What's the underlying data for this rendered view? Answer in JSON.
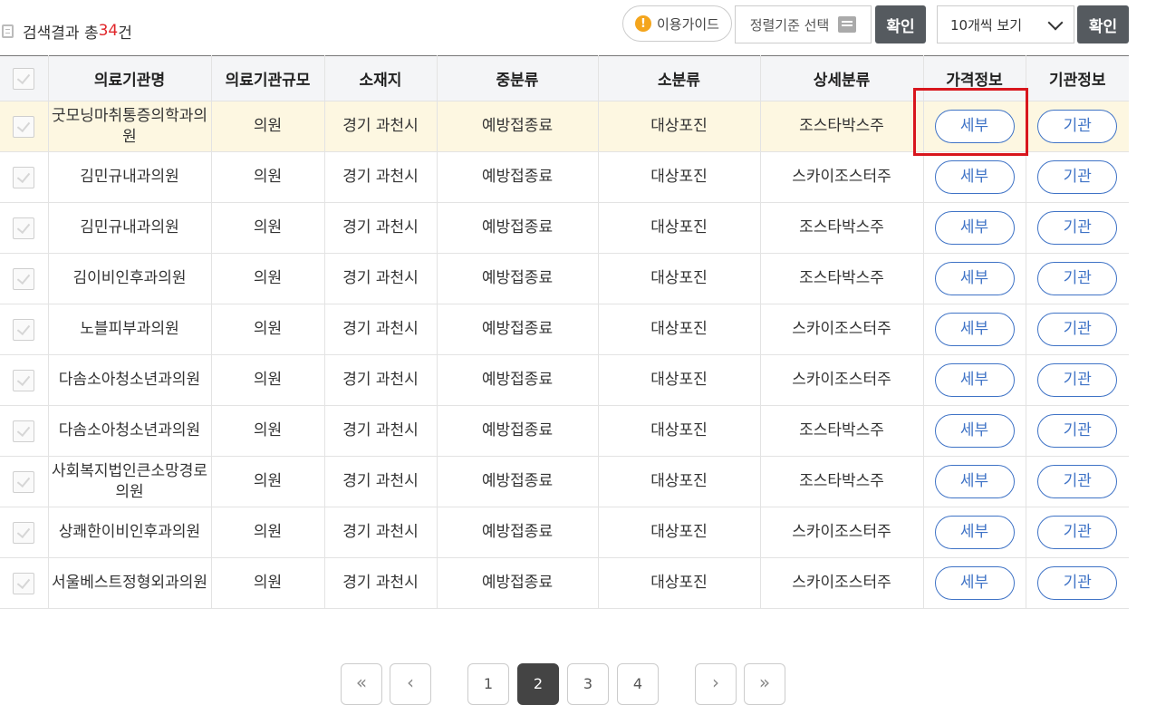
{
  "header": {
    "result_prefix": "검색결과 총",
    "result_count": "34",
    "result_suffix": "건",
    "guide_label": "이용가이드",
    "sort_label": "정렬기준 선택",
    "confirm_label": "확인",
    "view_select_value": "10개씩 보기",
    "confirm2_label": "확인"
  },
  "table": {
    "columns": [
      "의료기관명",
      "의료기관규모",
      "소재지",
      "중분류",
      "소분류",
      "상세분류",
      "가격정보",
      "기관정보"
    ],
    "detail_label": "세부",
    "org_label": "기관",
    "rows": [
      {
        "name": "굿모닝마취통증의학과의원",
        "size": "의원",
        "location": "경기 과천시",
        "mid": "예방접종료",
        "sub": "대상포진",
        "detail": "조스타박스주"
      },
      {
        "name": "김민규내과의원",
        "size": "의원",
        "location": "경기 과천시",
        "mid": "예방접종료",
        "sub": "대상포진",
        "detail": "스카이조스터주"
      },
      {
        "name": "김민규내과의원",
        "size": "의원",
        "location": "경기 과천시",
        "mid": "예방접종료",
        "sub": "대상포진",
        "detail": "조스타박스주"
      },
      {
        "name": "김이비인후과의원",
        "size": "의원",
        "location": "경기 과천시",
        "mid": "예방접종료",
        "sub": "대상포진",
        "detail": "조스타박스주"
      },
      {
        "name": "노블피부과의원",
        "size": "의원",
        "location": "경기 과천시",
        "mid": "예방접종료",
        "sub": "대상포진",
        "detail": "스카이조스터주"
      },
      {
        "name": "다솜소아청소년과의원",
        "size": "의원",
        "location": "경기 과천시",
        "mid": "예방접종료",
        "sub": "대상포진",
        "detail": "스카이조스터주"
      },
      {
        "name": "다솜소아청소년과의원",
        "size": "의원",
        "location": "경기 과천시",
        "mid": "예방접종료",
        "sub": "대상포진",
        "detail": "조스타박스주"
      },
      {
        "name": "사회복지법인큰소망경로의원",
        "size": "의원",
        "location": "경기 과천시",
        "mid": "예방접종료",
        "sub": "대상포진",
        "detail": "조스타박스주"
      },
      {
        "name": "상쾌한이비인후과의원",
        "size": "의원",
        "location": "경기 과천시",
        "mid": "예방접종료",
        "sub": "대상포진",
        "detail": "스카이조스터주"
      },
      {
        "name": "서울베스트정형외과의원",
        "size": "의원",
        "location": "경기 과천시",
        "mid": "예방접종료",
        "sub": "대상포진",
        "detail": "스카이조스터주"
      }
    ]
  },
  "pagination": {
    "pages": [
      "1",
      "2",
      "3",
      "4"
    ],
    "current": "2",
    "first_icon": "double-chevron-left-icon",
    "prev_icon": "chevron-left-icon",
    "next_icon": "chevron-right-icon",
    "last_icon": "double-chevron-right-icon"
  },
  "colors": {
    "count_red": "#e0262a",
    "accent_blue": "#3f73c6",
    "highlight_row": "#fdf7e1",
    "annotation_red": "#d8161d"
  }
}
